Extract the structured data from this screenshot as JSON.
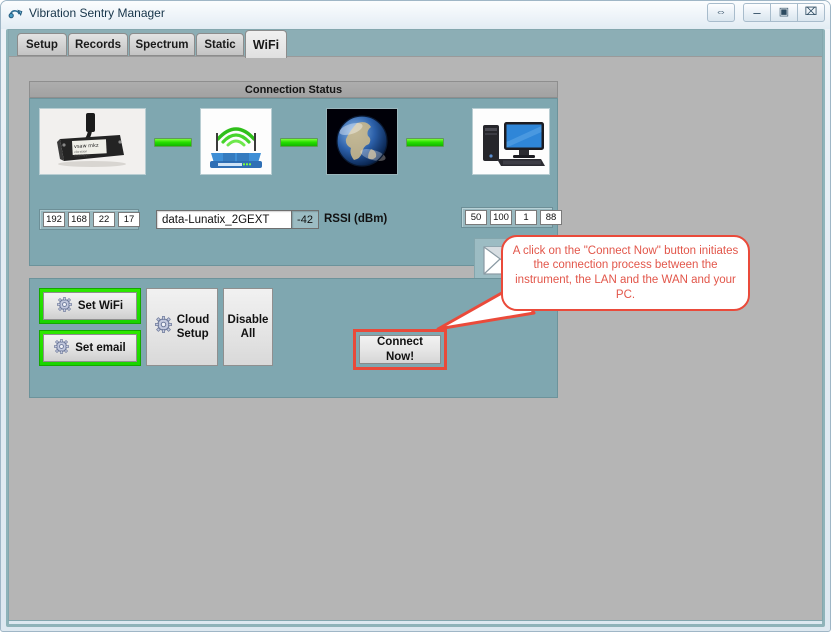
{
  "window": {
    "title": "Vibration Sentry Manager",
    "icon": "app-icon",
    "buttons": [
      {
        "name": "resize-button",
        "glyph": "⇔"
      },
      {
        "name": "minimize-button",
        "glyph": "–"
      },
      {
        "name": "maximize-button",
        "glyph": "▣"
      },
      {
        "name": "close-button",
        "glyph": "⌧"
      }
    ]
  },
  "tabs": [
    {
      "label": "Setup",
      "active": false
    },
    {
      "label": "Records",
      "active": false
    },
    {
      "label": "Spectrum",
      "active": false
    },
    {
      "label": "Static",
      "active": false
    },
    {
      "label": "WiFi",
      "active": true
    }
  ],
  "connection": {
    "group_title": "Connection Status",
    "nodes": [
      {
        "name": "instrument-image",
        "alt": "vsaw mkz vibration datalogger sensor"
      },
      {
        "name": "router-icon",
        "alt": "wifi router"
      },
      {
        "name": "globe-icon",
        "alt": "earth / internet"
      },
      {
        "name": "pc-icon",
        "alt": "desktop computer"
      }
    ],
    "instrument_ip": [
      "192",
      "168",
      "22",
      "17"
    ],
    "ssid": "data-Lunatix_2GEXT",
    "rssi_value": "-42",
    "rssi_label": "RSSI (dBm)",
    "pc_ip": [
      "50",
      "100",
      "1",
      "88"
    ],
    "mail_icon": "email-icon"
  },
  "actions": {
    "set_wifi": "Set WiFi",
    "set_email": "Set email",
    "cloud_setup_line1": "Cloud",
    "cloud_setup_line2": "Setup",
    "disable_all_line1": "Disable",
    "disable_all_line2": "All",
    "connect_line1": "Connect",
    "connect_line2": "Now!"
  },
  "callout": {
    "text": "A click on the \"Connect Now\" button initiates the connection process between the instrument, the LAN and the WAN and your PC.",
    "border_color": "#ea4a3a",
    "text_color": "#e2564a"
  },
  "colors": {
    "panel_teal": "#7fa7b0",
    "client_gray": "#b5b5b5",
    "tabstrip_teal": "#8caeb5",
    "link_green": "#27e000",
    "glow_green": "#19d400"
  }
}
